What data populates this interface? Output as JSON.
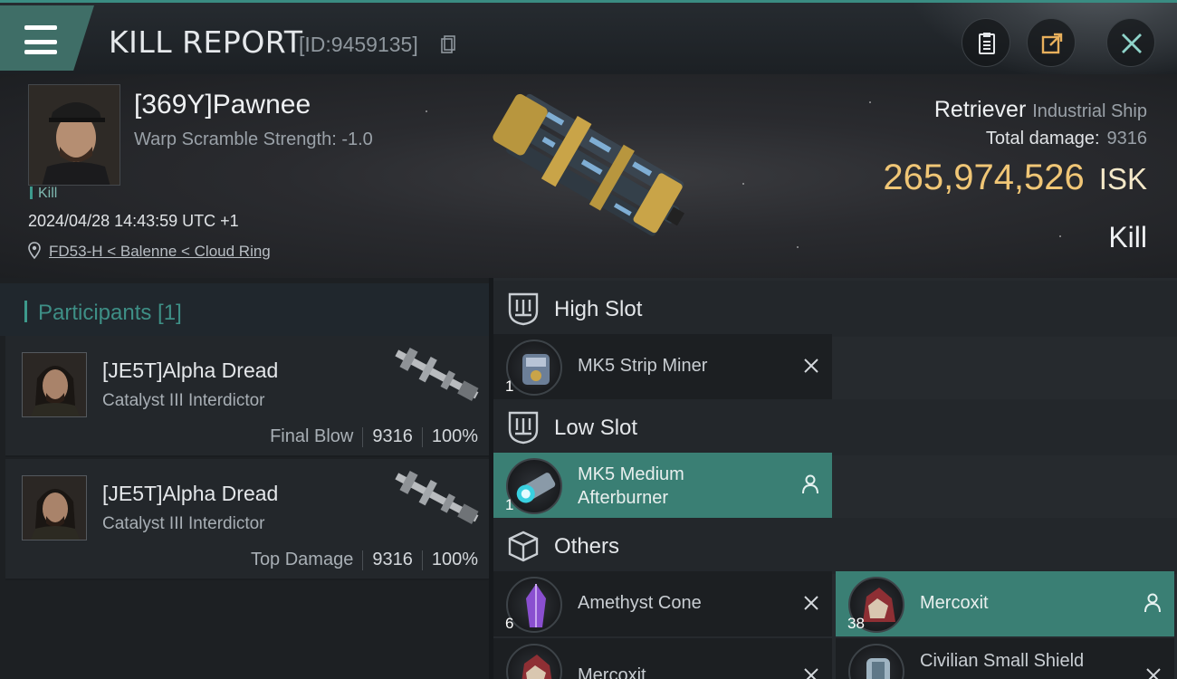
{
  "header": {
    "title": "KILL REPORT",
    "report_id": "[ID:9459135]"
  },
  "victim": {
    "name": "[369Y]Pawnee",
    "warp_scramble": "Warp Scramble Strength: -1.0",
    "tag": "Kill",
    "timestamp": "2024/04/28 14:43:59 UTC +1",
    "location": "FD53-H < Balenne < Cloud Ring",
    "ship_name": "Retriever",
    "ship_class": "Industrial Ship",
    "total_damage_label": "Total damage:",
    "total_damage": "9316",
    "isk_value": "265,974,526",
    "isk_unit": "ISK",
    "result": "Kill"
  },
  "participants": {
    "title": "Participants [1]",
    "rows": [
      {
        "name": "[JE5T]Alpha Dread",
        "ship": "Catalyst III Interdictor",
        "role": "Final Blow",
        "damage": "9316",
        "percent": "100%"
      },
      {
        "name": "[JE5T]Alpha Dread",
        "ship": "Catalyst III Interdictor",
        "role": "Top Damage",
        "damage": "9316",
        "percent": "100%"
      }
    ]
  },
  "fitting": {
    "high_slot": {
      "title": "High Slot",
      "items": [
        {
          "name": "MK5 Strip Miner",
          "qty": "1",
          "state": "destroyed"
        }
      ]
    },
    "low_slot": {
      "title": "Low Slot",
      "items": [
        {
          "name": "MK5 Medium Afterburner",
          "qty": "1",
          "state": "dropped"
        }
      ]
    },
    "others": {
      "title": "Others",
      "items": [
        {
          "name": "Amethyst Cone",
          "qty": "6",
          "state": "destroyed"
        },
        {
          "name": "Mercoxit",
          "qty": "38",
          "state": "dropped"
        },
        {
          "name": "Mercoxit",
          "qty": "",
          "state": "destroyed"
        },
        {
          "name": "Civilian Small Shield",
          "qty": "",
          "state": "destroyed"
        }
      ]
    }
  },
  "colors": {
    "accent": "#3a7f74",
    "isk": "#f0c676",
    "teal_text": "#3e8f86"
  }
}
